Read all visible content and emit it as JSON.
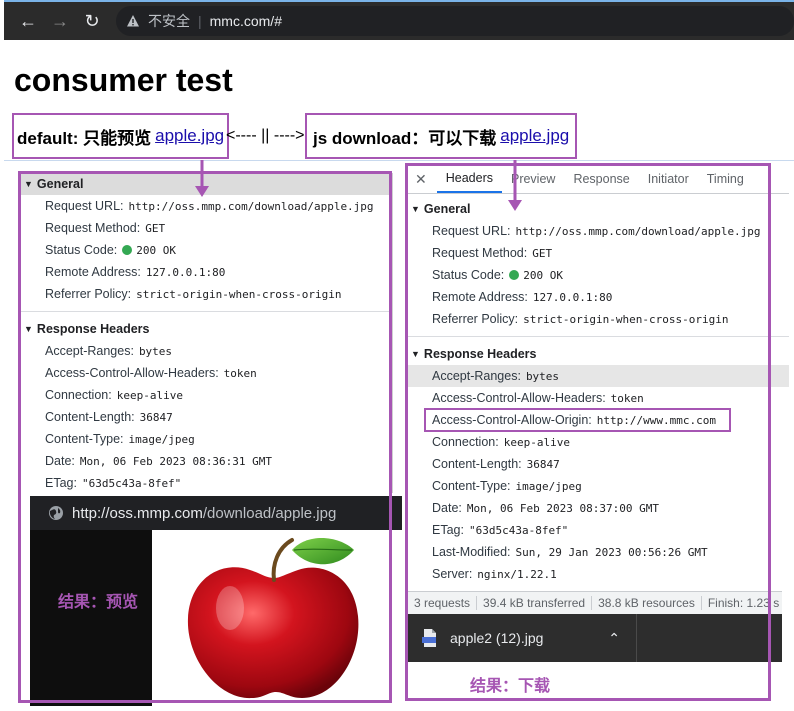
{
  "browser": {
    "insecure_label": "不安全",
    "url": "mmc.com/#"
  },
  "page": {
    "title": "consumer test",
    "default_prefix": "default: 只能预览",
    "default_link": "apple.jpg",
    "arrows_text": "<---- || ---->",
    "jsdl_prefix": "js download：可以下载",
    "jsdl_link": "apple.jpg"
  },
  "left_panel": {
    "general_title": "General",
    "general": [
      {
        "k": "Request URL:",
        "v": "http://oss.mmp.com/download/apple.jpg"
      },
      {
        "k": "Request Method:",
        "v": "GET"
      },
      {
        "k": "Status Code:",
        "v": "200 OK"
      },
      {
        "k": "Remote Address:",
        "v": "127.0.0.1:80"
      },
      {
        "k": "Referrer Policy:",
        "v": "strict-origin-when-cross-origin"
      }
    ],
    "response_title": "Response Headers",
    "response": [
      {
        "k": "Accept-Ranges:",
        "v": "bytes"
      },
      {
        "k": "Access-Control-Allow-Headers:",
        "v": "token"
      },
      {
        "k": "Connection:",
        "v": "keep-alive"
      },
      {
        "k": "Content-Length:",
        "v": "36847"
      },
      {
        "k": "Content-Type:",
        "v": "image/jpeg"
      },
      {
        "k": "Date:",
        "v": "Mon, 06 Feb 2023 08:36:31 GMT"
      },
      {
        "k": "ETag:",
        "v": "\"63d5c43a-8fef\""
      }
    ]
  },
  "right_panel": {
    "tabs": [
      "Headers",
      "Preview",
      "Response",
      "Initiator",
      "Timing"
    ],
    "general_title": "General",
    "general": [
      {
        "k": "Request URL:",
        "v": "http://oss.mmp.com/download/apple.jpg"
      },
      {
        "k": "Request Method:",
        "v": "GET"
      },
      {
        "k": "Status Code:",
        "v": "200 OK"
      },
      {
        "k": "Remote Address:",
        "v": "127.0.0.1:80"
      },
      {
        "k": "Referrer Policy:",
        "v": "strict-origin-when-cross-origin"
      }
    ],
    "response_title": "Response Headers",
    "response": [
      {
        "k": "Accept-Ranges:",
        "v": "bytes"
      },
      {
        "k": "Access-Control-Allow-Headers:",
        "v": "token"
      },
      {
        "k": "Access-Control-Allow-Origin:",
        "v": "http://www.mmc.com"
      },
      {
        "k": "Connection:",
        "v": "keep-alive"
      },
      {
        "k": "Content-Length:",
        "v": "36847"
      },
      {
        "k": "Content-Type:",
        "v": "image/jpeg"
      },
      {
        "k": "Date:",
        "v": "Mon, 06 Feb 2023 08:37:00 GMT"
      },
      {
        "k": "ETag:",
        "v": "\"63d5c43a-8fef\""
      },
      {
        "k": "Last-Modified:",
        "v": "Sun, 29 Jan 2023 00:56:26 GMT"
      },
      {
        "k": "Server:",
        "v": "nginx/1.22.1"
      }
    ],
    "status": {
      "requests": "3 requests",
      "transferred": "39.4 kB transferred",
      "resources": "38.8 kB resources",
      "finish": "Finish: 1.23 s"
    }
  },
  "preview": {
    "url_host": "http://oss.mmp.com",
    "url_path": "/download/apple.jpg"
  },
  "download": {
    "file_name": "apple2 (12).jpg"
  },
  "annotations": {
    "left_result": "结果：预览",
    "right_result": "结果：下载"
  },
  "colors": {
    "annotation": "#a656b3",
    "status_ok": "#34a853",
    "link": "#1a0dab"
  }
}
